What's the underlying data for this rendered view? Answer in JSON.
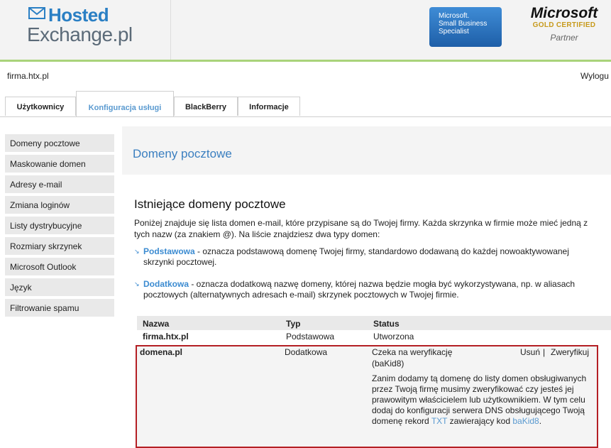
{
  "brand": {
    "logo_top": "Hosted",
    "logo_bottom": "Exchange.pl"
  },
  "badges": {
    "ms_lines": [
      "Microsoft.",
      "Small Business",
      "Specialist"
    ],
    "gold_title": "Microsoft",
    "gold_sub": "GOLD CERTIFIED",
    "gold_partner": "Partner"
  },
  "userbar": {
    "company": "firma.htx.pl",
    "logout": "Wylogu"
  },
  "tabs": [
    "Użytkownicy",
    "Konfiguracja usługi",
    "BlackBerry",
    "Informacje"
  ],
  "sidebar": [
    "Domeny pocztowe",
    "Maskowanie domen",
    "Adresy e-mail",
    "Zmiana loginów",
    "Listy dystrybucyjne",
    "Rozmiary skrzynek",
    "Microsoft Outlook",
    "Język",
    "Filtrowanie spamu"
  ],
  "main": {
    "page_title": "Domeny pocztowe",
    "section_title": "Istniejące domeny pocztowe",
    "description": "Poniżej znajduje się lista domen e-mail, które przypisane są do Twojej firmy. Każda skrzynka w firmie może mieć jedną z tych nazw (za znakiem @). Na liście znajdziesz dwa typy domen:",
    "bullet1_term": "Podstawowa",
    "bullet1_text": " - oznacza podstawową domenę Twojej firmy, standardowo dodawaną do każdej nowoaktywowanej skrzynki pocztowej.",
    "bullet2_term": "Dodatkowa",
    "bullet2_text": " - oznacza dodatkową nazwę domeny, której nazwa będzie mogła być wykorzystywana, np. w aliasach pocztowych (alternatywnych adresach e-mail) skrzynek pocztowych w Twojej firmie."
  },
  "table": {
    "headers": {
      "name": "Nazwa",
      "type": "Typ",
      "status": "Status"
    },
    "rows": [
      {
        "name": "firma.htx.pl",
        "type": "Podstawowa",
        "status": "Utworzona"
      },
      {
        "name": "domena.pl",
        "type": "Dodatkowa",
        "status": "Czeka na weryfikację",
        "code_paren": "(baKid8)",
        "action_delete": "Usuń",
        "action_verify": "Zweryfikuj",
        "info_text": "Zanim dodamy tą domenę do listy domen obsługiwanych przez Twoją firmę musimy zweryfikować czy jesteś jej prawowitym właścicielem lub użytkownikiem. W tym celu dodaj do konfiguracji serwera DNS obsługującego Twoją domenę rekord",
        "info_txt_word": "TXT",
        "info_mid": " zawierający kod ",
        "info_code": "baKid8",
        "info_end": "."
      }
    ]
  },
  "colors": {
    "accent": "#3b7fc0",
    "link": "#5a9ad0",
    "highlight_border": "#b41f24",
    "header_line": "#a9d37a"
  }
}
